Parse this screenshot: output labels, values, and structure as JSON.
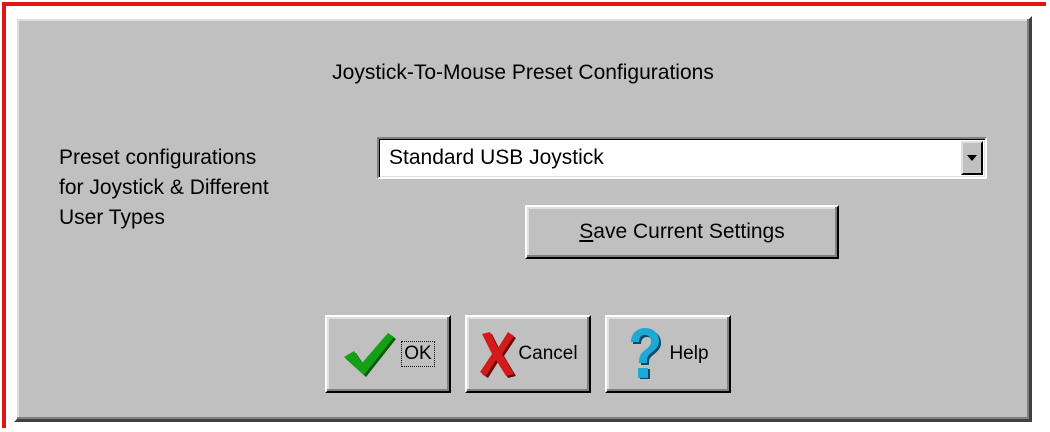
{
  "dialog": {
    "title": "Joystick-To-Mouse Preset Configurations",
    "preset_label": "Preset configurations\nfor Joystick & Different\nUser Types",
    "preset_select": {
      "value": "Standard USB Joystick"
    },
    "save_button": {
      "mnemonic": "S",
      "rest": "ave Current Settings"
    },
    "buttons": {
      "ok": "OK",
      "cancel": "Cancel",
      "help": "Help"
    },
    "icons": {
      "ok": "checkmark-icon",
      "cancel": "x-cross-icon",
      "help": "question-mark-icon"
    },
    "colors": {
      "face": "#c0c0c0",
      "frame_accent": "#e31414",
      "check_green": "#14a014",
      "cross_red": "#d41a1a",
      "help_blue": "#1ea8d6"
    }
  }
}
